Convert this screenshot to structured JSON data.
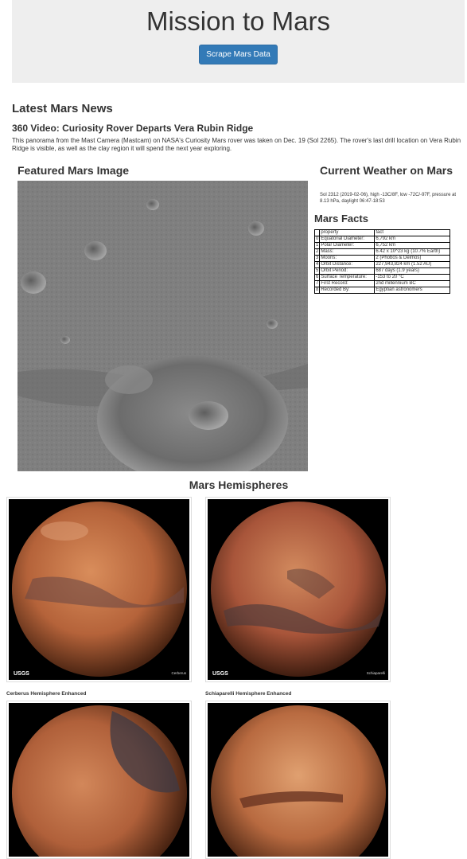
{
  "header": {
    "title": "Mission to Mars",
    "scrape_button": "Scrape Mars Data"
  },
  "news": {
    "heading": "Latest Mars News",
    "title": "360 Video: Curiosity Rover Departs Vera Rubin Ridge",
    "paragraph": "This panorama from the Mast Camera (Mastcam) on NASA's Curiosity Mars rover was taken on Dec. 19 (Sol 2265). The rover's last drill location on Vera Rubin Ridge is visible, as well as the clay region it will spend the next year exploring."
  },
  "featured": {
    "heading": "Featured Mars Image"
  },
  "weather": {
    "heading": "Current Weather on Mars",
    "text": "Sol 2312 (2019-02-06), high -13C/8F, low -72C/-97F, pressure at 8.13 hPa, daylight 06:47-18:53"
  },
  "facts": {
    "heading": "Mars Facts",
    "columns": [
      "property",
      "fact"
    ],
    "rows": [
      {
        "index": "0",
        "property": "Equatorial Diameter:",
        "fact": "6,792 km"
      },
      {
        "index": "1",
        "property": "Polar Diameter:",
        "fact": "6,752 km"
      },
      {
        "index": "2",
        "property": "Mass:",
        "fact": "6.42 x 10^23 kg (10.7% Earth)"
      },
      {
        "index": "3",
        "property": "Moons:",
        "fact": "2 (Phobos & Deimos)"
      },
      {
        "index": "4",
        "property": "Orbit Distance:",
        "fact": "227,943,824 km (1.52 AU)"
      },
      {
        "index": "5",
        "property": "Orbit Period:",
        "fact": "687 days (1.9 years)"
      },
      {
        "index": "6",
        "property": "Surface Temperature:",
        "fact": "-153 to 20 °C"
      },
      {
        "index": "7",
        "property": "First Record:",
        "fact": "2nd millennium BC"
      },
      {
        "index": "8",
        "property": "Recorded By:",
        "fact": "Egyptian astronomers"
      }
    ]
  },
  "hemispheres": {
    "heading": "Mars Hemispheres",
    "items": [
      {
        "caption": "Cerberus Hemisphere Enhanced",
        "corner": "Cerberus",
        "logo": "USGS"
      },
      {
        "caption": "Schiaparelli Hemisphere Enhanced",
        "corner": "Schiaparelli",
        "logo": "USGS"
      },
      {
        "caption": "",
        "corner": "",
        "logo": ""
      },
      {
        "caption": "",
        "corner": "",
        "logo": ""
      }
    ]
  },
  "colors": {
    "button": "#337ab7",
    "jumbotron": "#eeeeee",
    "mars": "#b5633a"
  }
}
